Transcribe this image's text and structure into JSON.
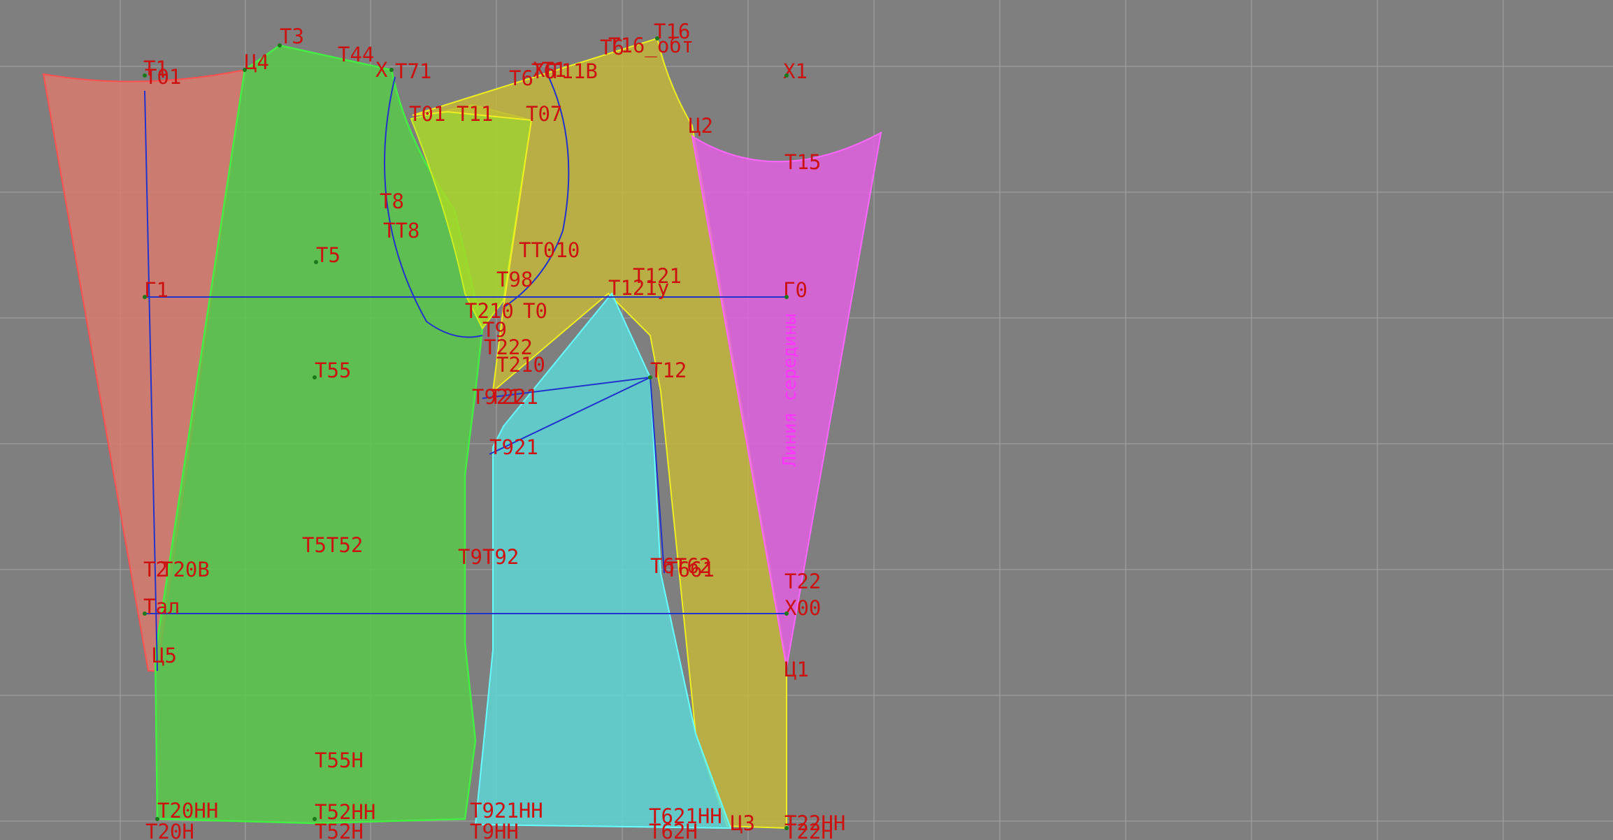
{
  "colors": {
    "background": "#7f7f7f",
    "grid": "#9c9c9c",
    "label": "#cc1111",
    "piece_sleeve_back": "#e07a6a",
    "piece_back": "#58cc48",
    "piece_side": "#a8d828",
    "piece_front_side": "#5cd8d8",
    "piece_front": "#c4b838",
    "piece_sleeve_front": "#e060e0",
    "construction_line": "#2233cc"
  },
  "pieces": [
    {
      "name": "sleeve-back-piece",
      "color_key": "piece_sleeve_back"
    },
    {
      "name": "back-piece",
      "color_key": "piece_back"
    },
    {
      "name": "side-panel-piece",
      "color_key": "piece_side"
    },
    {
      "name": "front-side-piece",
      "color_key": "piece_front_side"
    },
    {
      "name": "front-piece",
      "color_key": "piece_front"
    },
    {
      "name": "sleeve-front-piece",
      "color_key": "piece_sleeve_front"
    }
  ],
  "labels": [
    {
      "text": "Т3"
    },
    {
      "text": "Т44"
    },
    {
      "text": "Х"
    },
    {
      "text": "Т71"
    },
    {
      "text": "Т16"
    },
    {
      "text": "Т16_обт"
    },
    {
      "text": "Т6"
    },
    {
      "text": "Т6"
    },
    {
      "text": "Х1"
    },
    {
      "text": "Т1"
    },
    {
      "text": "Т01"
    },
    {
      "text": "Ц4"
    },
    {
      "text": "Т6"
    },
    {
      "text": "Т1"
    },
    {
      "text": "Х"
    },
    {
      "text": "Т11В"
    },
    {
      "text": "Т01"
    },
    {
      "text": "Т11"
    },
    {
      "text": "Т07"
    },
    {
      "text": "Ц2"
    },
    {
      "text": "Т15"
    },
    {
      "text": "Т8"
    },
    {
      "text": "ТТ8"
    },
    {
      "text": "Т5"
    },
    {
      "text": "ТТ010"
    },
    {
      "text": "Т98"
    },
    {
      "text": "Т121"
    },
    {
      "text": "Т121у"
    },
    {
      "text": "Г1"
    },
    {
      "text": "Г0"
    },
    {
      "text": "Т210"
    },
    {
      "text": "Т0"
    },
    {
      "text": "Т9"
    },
    {
      "text": "Т222"
    },
    {
      "text": "Т210"
    },
    {
      "text": "Т12"
    },
    {
      "text": "Т55"
    },
    {
      "text": "Т921"
    },
    {
      "text": "Т221"
    },
    {
      "text": "Т921"
    },
    {
      "text": "Т5Т52"
    },
    {
      "text": "Т9Т92"
    },
    {
      "text": "Т6Т62"
    },
    {
      "text": "Т661"
    },
    {
      "text": "Т22"
    },
    {
      "text": "Т2"
    },
    {
      "text": "Т20В"
    },
    {
      "text": "Тал"
    },
    {
      "text": "Х00"
    },
    {
      "text": "Ц5"
    },
    {
      "text": "Ц1"
    },
    {
      "text": "Т55Н"
    },
    {
      "text": "Т20НН"
    },
    {
      "text": "Т52НН"
    },
    {
      "text": "Т921НН"
    },
    {
      "text": "Т621НН"
    },
    {
      "text": "Ц3"
    },
    {
      "text": "Т22НН"
    },
    {
      "text": "Т20Н"
    },
    {
      "text": "Т52Н"
    },
    {
      "text": "Т9НН"
    },
    {
      "text": "Т62Н"
    },
    {
      "text": "Т22Н"
    }
  ],
  "vertical_label": {
    "text": "Линия середины"
  }
}
